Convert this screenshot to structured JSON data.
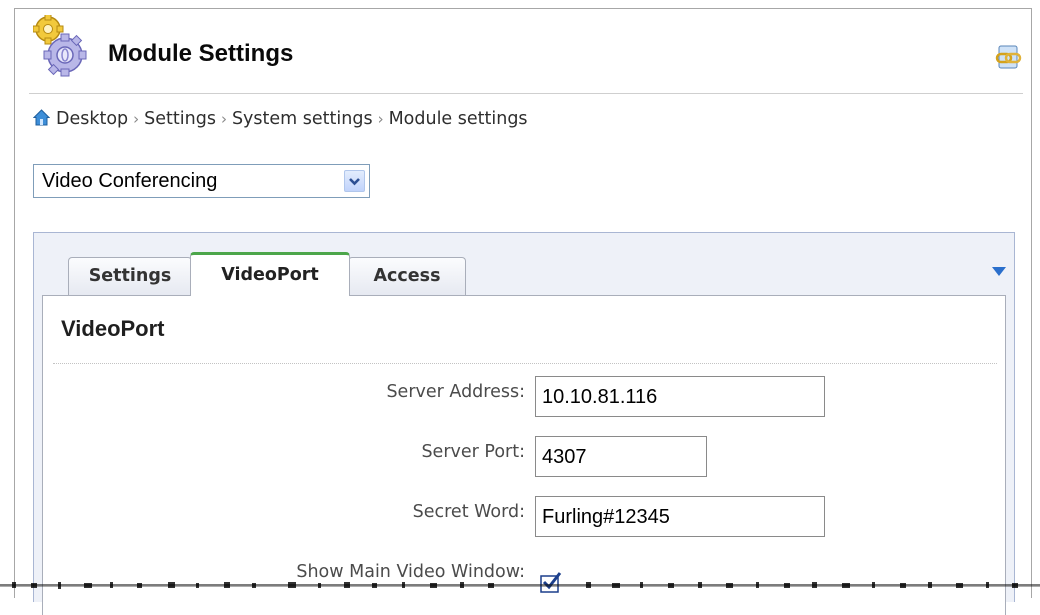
{
  "header": {
    "title": "Module Settings"
  },
  "breadcrumb": {
    "items": [
      "Desktop",
      "Settings",
      "System settings",
      "Module settings"
    ],
    "separator": "›"
  },
  "module_select": {
    "value": "Video Conferencing"
  },
  "tabs": [
    {
      "label": "Settings",
      "active": false
    },
    {
      "label": "VideoPort",
      "active": true
    },
    {
      "label": "Access",
      "active": false
    }
  ],
  "section": {
    "title": "VideoPort"
  },
  "fields": {
    "server_address": {
      "label": "Server Address:",
      "value": "10.10.81.116"
    },
    "server_port": {
      "label": "Server Port:",
      "value": "4307"
    },
    "secret_word": {
      "label": "Secret Word:",
      "value": "Furling#12345"
    },
    "show_main_video": {
      "label": "Show Main Video Window:",
      "checked": true
    }
  },
  "colors": {
    "active_tab_accent": "#4ca64a",
    "panel_background": "#eef1f8",
    "panel_border": "#a9b6d3",
    "link_color": "#2e2e2e"
  }
}
